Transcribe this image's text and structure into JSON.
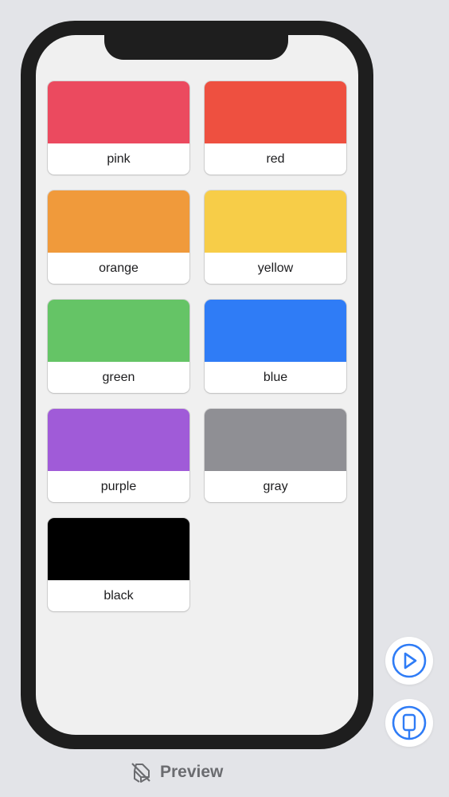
{
  "colors": {
    "accent": "#2f7cf6",
    "frame": "#1e1e1e",
    "screen_bg": "#f0f0f0",
    "canvas_bg": "#e3e4e8"
  },
  "grid": {
    "cards": [
      {
        "label": "pink",
        "color": "#eb4a5f"
      },
      {
        "label": "red",
        "color": "#ee5040"
      },
      {
        "label": "orange",
        "color": "#f09a3b"
      },
      {
        "label": "yellow",
        "color": "#f7cd48"
      },
      {
        "label": "green",
        "color": "#65c466"
      },
      {
        "label": "blue",
        "color": "#2f7cf6"
      },
      {
        "label": "purple",
        "color": "#a05bd8"
      },
      {
        "label": "gray",
        "color": "#8f8f94"
      },
      {
        "label": "black",
        "color": "#000000"
      }
    ]
  },
  "side_controls": {
    "play_icon": "play-circle-icon",
    "device_icon": "device-icon"
  },
  "footer": {
    "preview_icon": "preview-paused-icon",
    "preview_label": "Preview"
  }
}
